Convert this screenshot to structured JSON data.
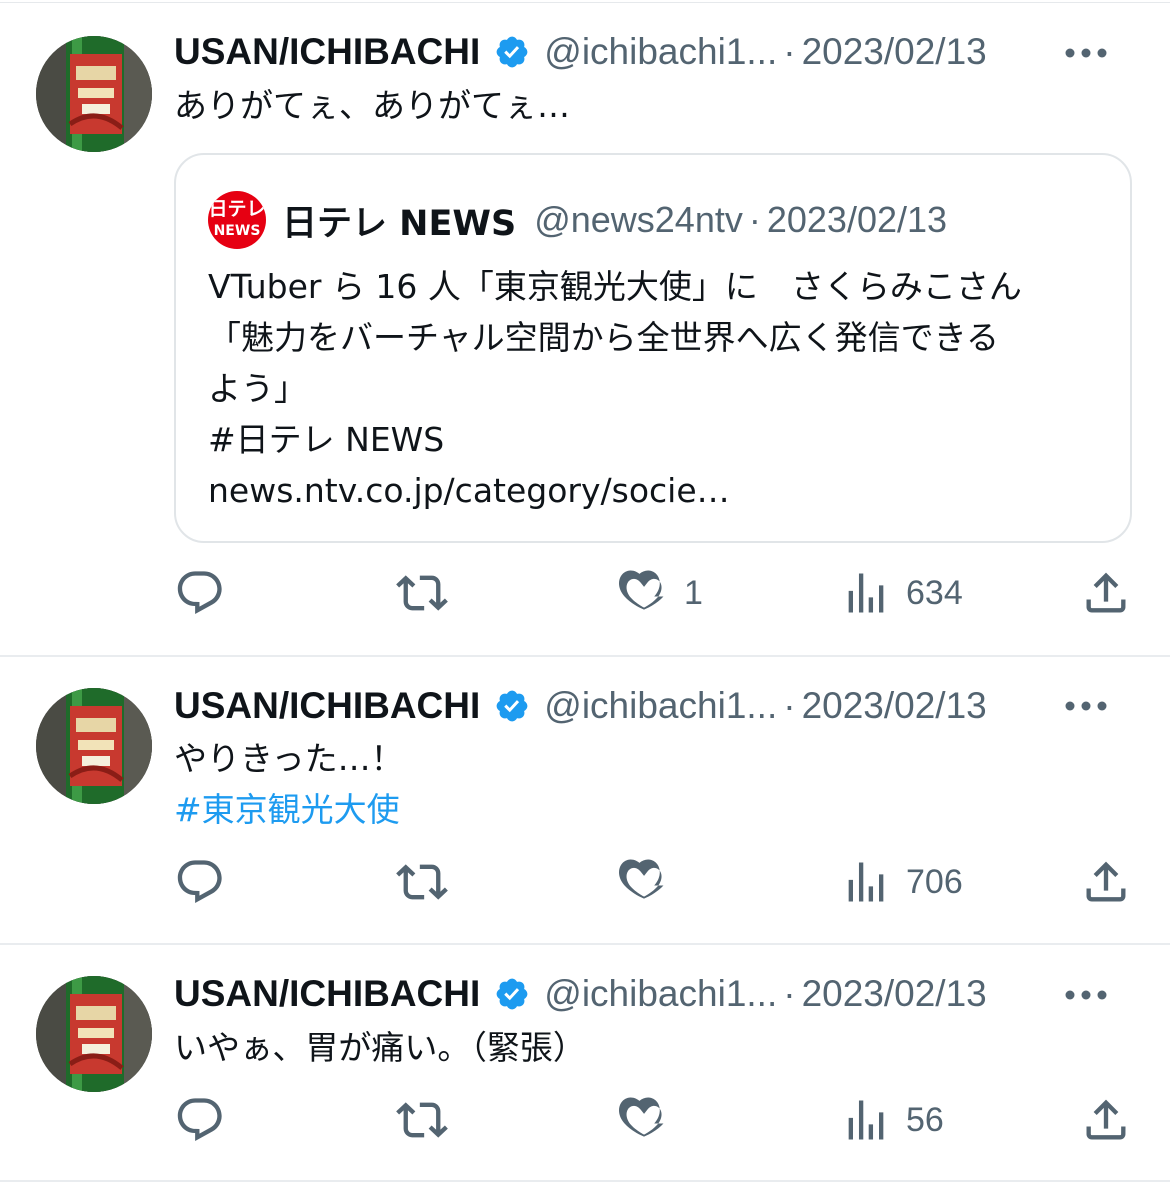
{
  "tweets": [
    {
      "author_name": "USAN/ICHIBACHI",
      "handle": "@ichibachi1...",
      "separator": "·",
      "date": "2023/02/13",
      "text": "ありがてぇ、ありがてぇ…",
      "quote": {
        "logo_line1": "日テレ",
        "logo_line2": "NEWS",
        "author_name": "日テレ NEWS",
        "handle": "@news24ntv",
        "separator": "·",
        "date": "2023/02/13",
        "text": "VTuber ら 16 人「東京観光大使」に　さくらみこさん\n「魅力をバーチャル空間から全世界へ広く発信できる\nよう」\n#日テレ NEWS\nnews.ntv.co.jp/category/socie…"
      },
      "likes": "1",
      "views": "634"
    },
    {
      "author_name": "USAN/ICHIBACHI",
      "handle": "@ichibachi1...",
      "separator": "·",
      "date": "2023/02/13",
      "text": "やりきった…！",
      "hashtag": "#東京観光大使",
      "likes": "",
      "views": "706"
    },
    {
      "author_name": "USAN/ICHIBACHI",
      "handle": "@ichibachi1...",
      "separator": "·",
      "date": "2023/02/13",
      "text": "いやぁ、胃が痛い。（緊張）",
      "likes": "",
      "views": "56"
    }
  ],
  "icons": {
    "verified": "verified-badge-icon",
    "more": "more-icon",
    "reply": "reply-icon",
    "retweet": "retweet-icon",
    "like": "like-icon",
    "views": "views-icon",
    "share": "share-icon"
  },
  "colors": {
    "verified": "#1d9bf0",
    "hashtag": "#1d9bf0",
    "secondary_text": "#536471",
    "action_icon": "#536471",
    "ntv_red": "#e60012"
  }
}
